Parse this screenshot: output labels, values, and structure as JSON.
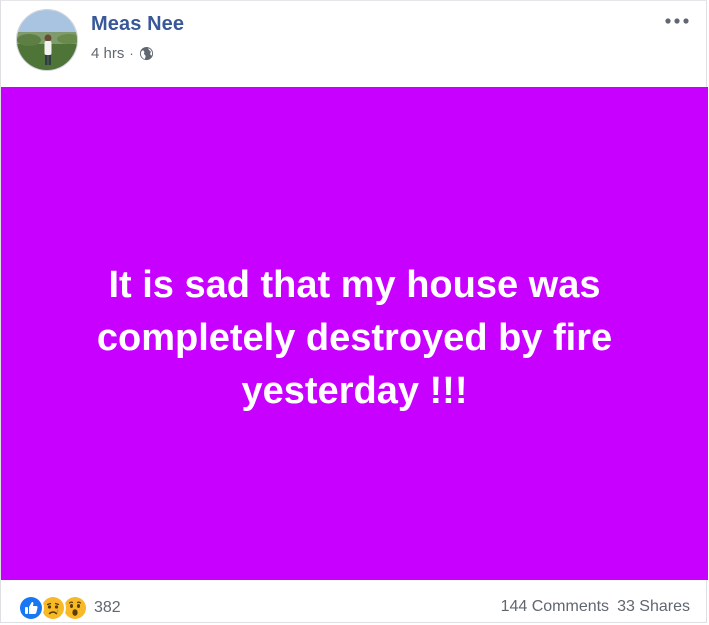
{
  "post": {
    "author": "Meas Nee",
    "time": "4 hrs",
    "separator": "·",
    "privacy_icon": "globe-icon",
    "more_icon": "more-options-icon",
    "text": "It is sad that my house was completely destroyed by fire yesterday !!!",
    "background_color": "#c800ff"
  },
  "footer": {
    "reactions": [
      "like-icon",
      "sad-icon",
      "wow-icon"
    ],
    "reaction_count": "382",
    "comments": "144 Comments",
    "shares": "33 Shares"
  },
  "colors": {
    "author_link": "#385898",
    "meta_text": "#606770",
    "like_blue": "#1877f2",
    "emoji_yellow": "#f7b928"
  }
}
